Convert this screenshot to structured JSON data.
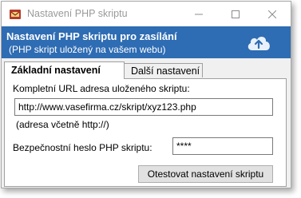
{
  "window": {
    "title": "Nastavení PHP skriptu",
    "icon": "app-icon",
    "controls": {
      "minimize": "–",
      "maximize": "☐",
      "close": "✕"
    }
  },
  "banner": {
    "title": "Nastavení PHP skriptu pro zasílání",
    "subtitle": "(PHP skript uložený na vašem webu)",
    "icon": "cloud-upload-icon",
    "color": "#2e6cb3"
  },
  "tabs": [
    {
      "label": "Základní nastavení",
      "active": true
    },
    {
      "label": "Další nastavení",
      "active": false
    }
  ],
  "form": {
    "url_label": "Kompletní URL adresa uloženého skriptu:",
    "url_value": "http://www.vasefirma.cz/skript/xyz123.php",
    "url_hint": "(adresa včetně http://)",
    "password_label": "Bezpečnostní heslo PHP skriptu:",
    "password_value": "****",
    "test_button": "Otestovat nastavení skriptu"
  }
}
